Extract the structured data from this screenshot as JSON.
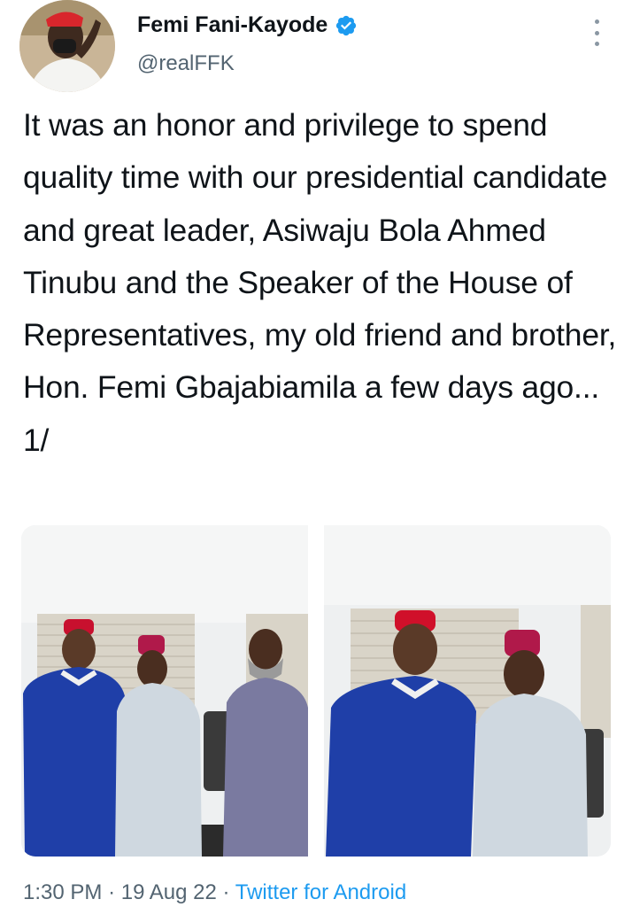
{
  "author": {
    "name": "Femi Fani-Kayode",
    "handle": "@realFFK",
    "verified": true
  },
  "tweet": {
    "text": "It was an honor and privilege to spend quality time with our presidential candidate and great leader, Asiwaju Bola Ahmed Tinubu and the Speaker of the House of Representatives, my old friend and brother, Hon. Femi Gbajabiamila a few days ago... 1/",
    "time": "1:30 PM",
    "date": "19 Aug 22",
    "separator": "·",
    "source": "Twitter for Android"
  },
  "icons": {
    "verified": "verified-badge-icon",
    "more": "more-vertical-icon"
  },
  "colors": {
    "accent": "#1d9bf0",
    "text": "#0f1419",
    "secondary": "#536471"
  }
}
